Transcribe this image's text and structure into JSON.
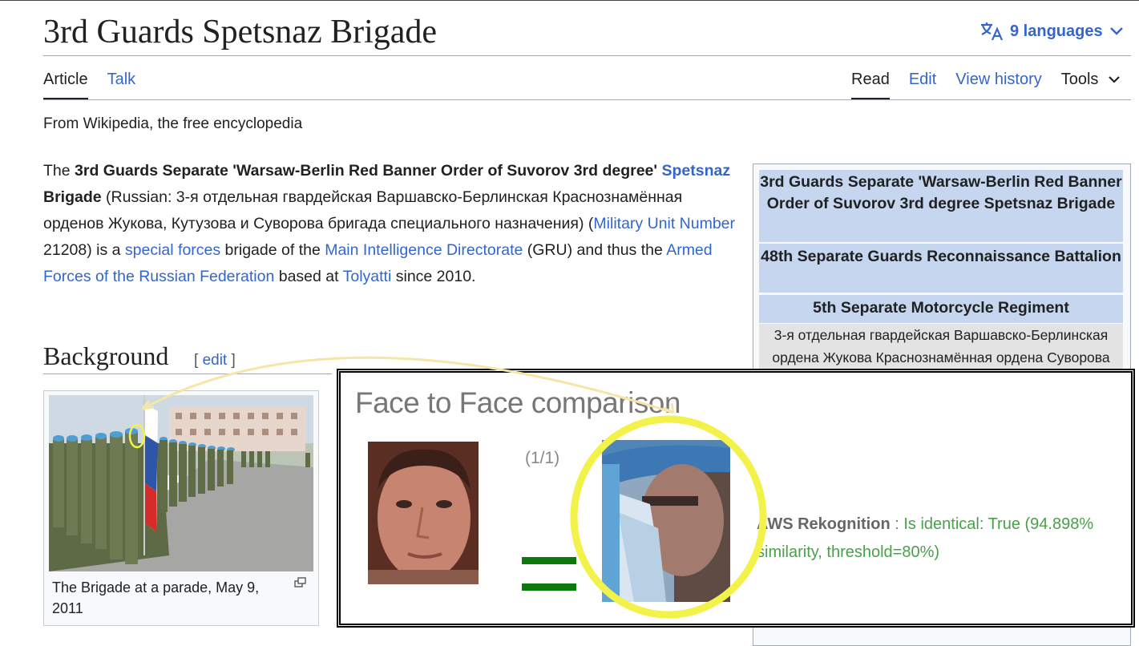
{
  "page": {
    "title": "3rd Guards Spetsnaz Brigade",
    "languages_label": "9 languages",
    "tabs_left": [
      "Article",
      "Talk"
    ],
    "tabs_right": [
      "Read",
      "Edit",
      "View history",
      "Tools"
    ],
    "tagline": "From Wikipedia, the free encyclopedia"
  },
  "lead": {
    "the": "The ",
    "bold_name": "3rd Guards Separate 'Warsaw-Berlin Red Banner Order of Suvorov 3rd degree'",
    "space1": " ",
    "link_spetsnaz": "Spetsnaz",
    "bold_brigade": " Brigade",
    "russian": " (Russian: 3-я отдельная гвардейская Варшавско-Берлинская Краснознамённая орденов Жукова, Кутузова и Суворова бригада специального назначения) (",
    "link_unit": "Military Unit Number",
    "unit_no": " 21208) is a ",
    "link_sf": "special forces",
    "text2": " brigade of the ",
    "link_mid": "Main Intelligence Directorate",
    "text3": " (GRU) and thus the ",
    "link_afrf": "Armed Forces of the Russian Federation",
    "text4": " based at ",
    "link_tol": "Tolyatti",
    "text5": " since 2010."
  },
  "background": {
    "heading": "Background",
    "edit_label": "[ edit ]",
    "caption": "The Brigade at a parade, May 9, 2011"
  },
  "infobox": {
    "row1": "3rd Guards Separate 'Warsaw-Berlin Red Banner Order of Suvorov 3rd degree Spetsnaz Brigade",
    "row2": "48th Separate Guards Reconnaissance Battalion",
    "row3": "5th Separate Motorcycle Regiment",
    "native": "3-я отдельная гвардейская Варшавско-Берлинская ордена Жукова Краснознамённая ордена Суворова"
  },
  "overlay": {
    "title": "Face to Face comparison",
    "count": "(1/1)",
    "service": "AWS Rekognition",
    "result": " : Is identical: True (94.898% similarity, threshold=80%)"
  },
  "colors": {
    "link": "#3366cc",
    "infobox_header": "#c5d6ee",
    "highlight": "#f2f24a",
    "match_green": "#0b7a0b"
  }
}
